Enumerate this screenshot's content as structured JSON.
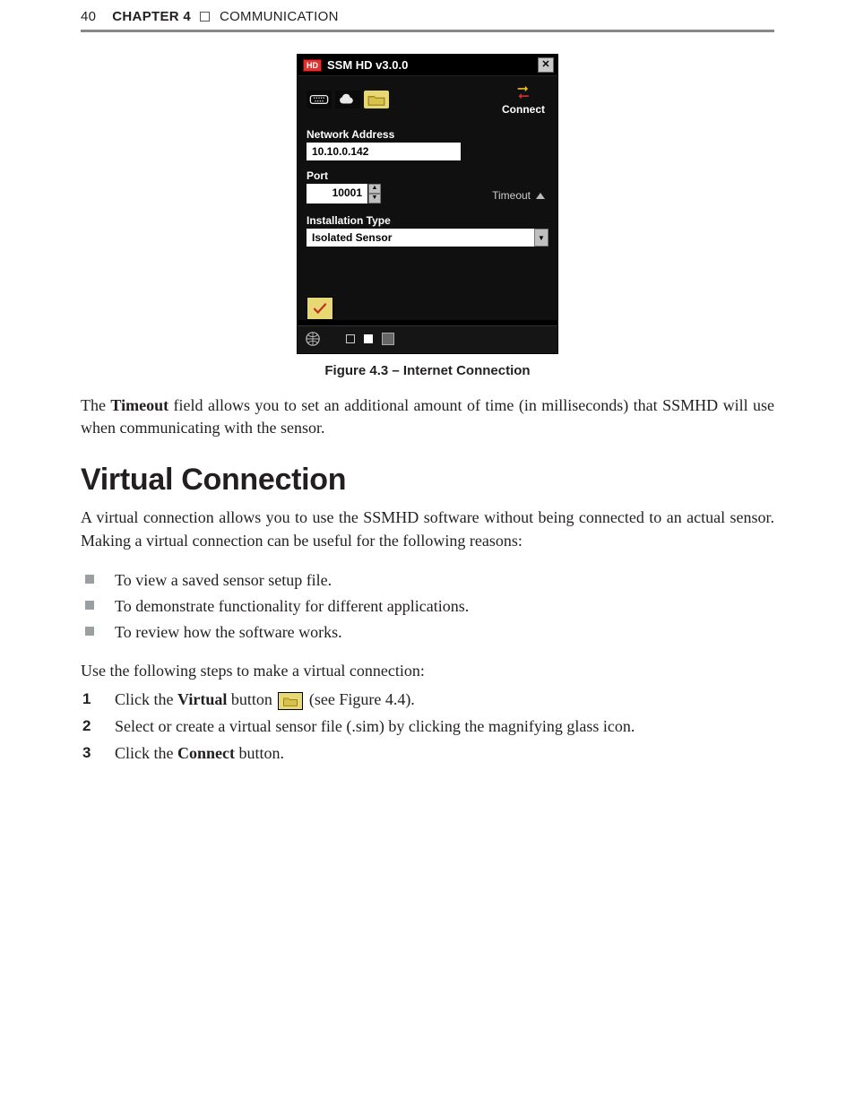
{
  "header": {
    "page_number": "40",
    "chapter_label": "CHAPTER 4",
    "chapter_title": "COMMUNICATION"
  },
  "dialog": {
    "hd_badge": "HD",
    "title": "SSM HD v3.0.0",
    "close_glyph": "✕",
    "connect_label": "Connect",
    "network_address_label": "Network Address",
    "network_address_value": "10.10.0.142",
    "port_label": "Port",
    "port_value": "10001",
    "timeout_label": "Timeout",
    "install_type_label": "Installation Type",
    "install_type_value": "Isolated Sensor",
    "icons": {
      "serial": "serial-icon",
      "internet": "internet-icon",
      "virtual": "virtual-icon",
      "connect_arrows": "connect-arrows-icon",
      "check": "check-icon",
      "globe": "globe-icon"
    }
  },
  "figure_caption": "Figure 4.3 – Internet Connection",
  "para_timeout_a": "The ",
  "para_timeout_b": "Timeout",
  "para_timeout_c": " field allows you to set an additional amount of time (in milliseconds) that SSMHD will use when communicating with the sensor.",
  "section_heading": "Virtual Connection",
  "para_vc_intro": "A virtual connection allows you to use the SSMHD software without being connected to an actual sensor. Making a virtual connection can be useful for the following reasons:",
  "bullets": [
    "To view a saved sensor setup file.",
    "To demonstrate functionality for different applications.",
    "To review how the software works."
  ],
  "para_steps_intro": "Use the following steps to make a virtual connection:",
  "steps": {
    "s1_a": "Click the ",
    "s1_b": "Virtual",
    "s1_c": " button ",
    "s1_d": " (see Figure 4.4).",
    "s2": "Select or create a virtual sensor file (.sim) by clicking the magnifying glass icon.",
    "s3_a": "Click the ",
    "s3_b": "Connect",
    "s3_c": " button."
  }
}
